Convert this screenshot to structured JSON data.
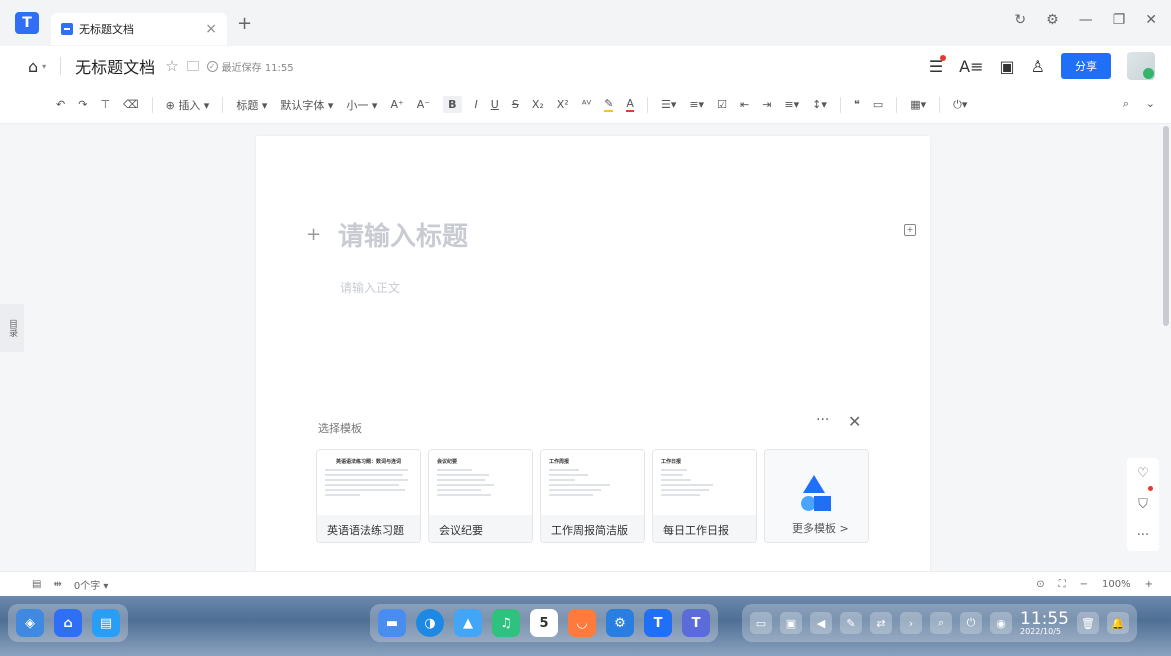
{
  "tab": {
    "title": "无标题文档"
  },
  "doc": {
    "title": "无标题文档",
    "saved": "最近保存 11:55",
    "share": "分享"
  },
  "toolbar": {
    "insert": "插入",
    "heading": "标题",
    "font": "默认字体",
    "size": "小一",
    "bold": "B",
    "italic": "I",
    "underline": "U",
    "strike": "S",
    "sub": "X₂",
    "sup": "X²"
  },
  "editor": {
    "title_placeholder": "请输入标题",
    "body_placeholder": "请输入正文"
  },
  "sidebar": {
    "toc": "目录"
  },
  "templates": {
    "label": "选择模板",
    "items": [
      {
        "name": "英语语法练习题",
        "preview_title": "英语语法练习题：数词与连词"
      },
      {
        "name": "会议纪要",
        "preview_title": "会议纪要"
      },
      {
        "name": "工作周报简洁版",
        "preview_title": "工作周报"
      },
      {
        "name": "每日工作日报",
        "preview_title": "工作日报"
      }
    ],
    "more": "更多模板 >"
  },
  "status": {
    "word_count": "0个字",
    "zoom": "100%"
  },
  "taskbar": {
    "time": "11:55",
    "date": "2022/10/5"
  }
}
